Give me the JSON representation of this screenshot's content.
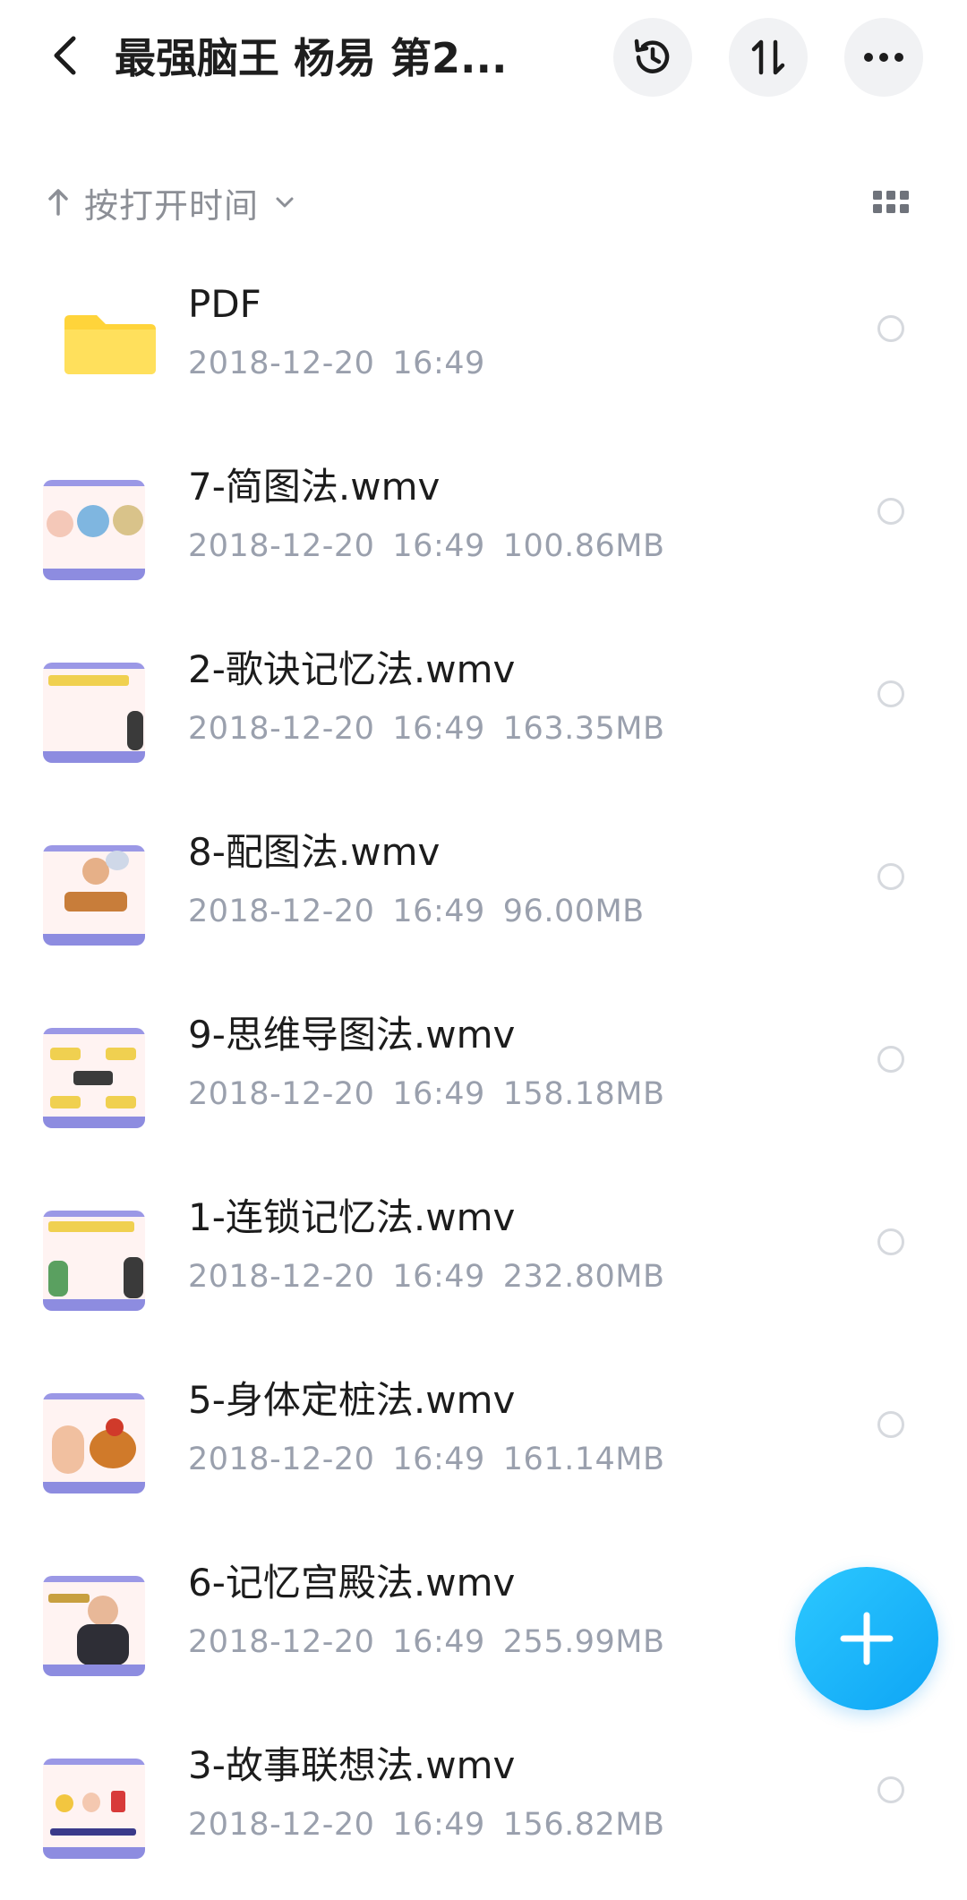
{
  "header": {
    "title": "最强脑王 杨易 第2...",
    "back_icon": "back-arrow-icon",
    "history_icon": "history-icon",
    "sort_icon": "sort-arrows-icon",
    "more_icon": "more-dots-icon"
  },
  "sortbar": {
    "label": "按打开时间",
    "direction_icon": "arrow-up-icon",
    "dropdown_icon": "chevron-down-icon",
    "view_icon": "grid-view-icon"
  },
  "files": [
    {
      "name": "PDF",
      "date": "2018-12-20",
      "time": "16:49",
      "size": "",
      "type": "folder"
    },
    {
      "name": "7-简图法.wmv",
      "date": "2018-12-20",
      "time": "16:49",
      "size": "100.86MB",
      "type": "video"
    },
    {
      "name": "2-歌诀记忆法.wmv",
      "date": "2018-12-20",
      "time": "16:49",
      "size": "163.35MB",
      "type": "video"
    },
    {
      "name": "8-配图法.wmv",
      "date": "2018-12-20",
      "time": "16:49",
      "size": "96.00MB",
      "type": "video"
    },
    {
      "name": "9-思维导图法.wmv",
      "date": "2018-12-20",
      "time": "16:49",
      "size": "158.18MB",
      "type": "video"
    },
    {
      "name": "1-连锁记忆法.wmv",
      "date": "2018-12-20",
      "time": "16:49",
      "size": "232.80MB",
      "type": "video"
    },
    {
      "name": "5-身体定桩法.wmv",
      "date": "2018-12-20",
      "time": "16:49",
      "size": "161.14MB",
      "type": "video"
    },
    {
      "name": "6-记忆宫殿法.wmv",
      "date": "2018-12-20",
      "time": "16:49",
      "size": "255.99MB",
      "type": "video"
    },
    {
      "name": "3-故事联想法.wmv",
      "date": "2018-12-20",
      "time": "16:49",
      "size": "156.82MB",
      "type": "video"
    }
  ],
  "fab": {
    "icon": "plus-icon"
  },
  "colors": {
    "folder": "#ffd43a",
    "fab": "#19b4fa",
    "meta_text": "#9aa0ad",
    "thumb_band": "#8d8ce0"
  }
}
